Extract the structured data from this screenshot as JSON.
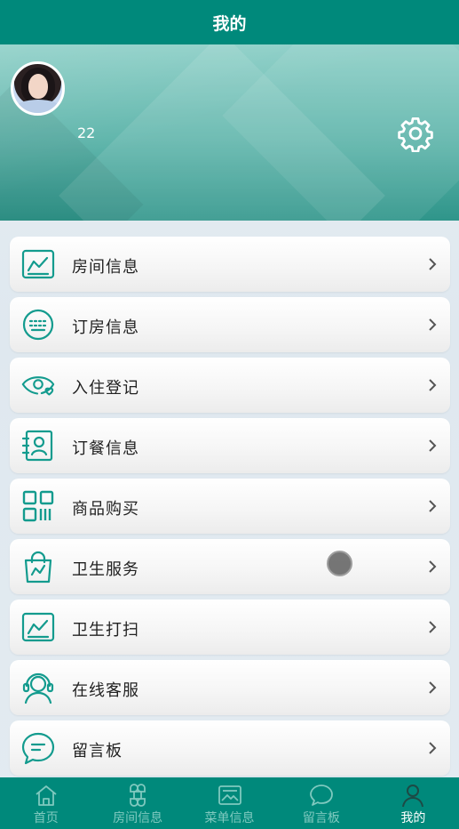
{
  "header": {
    "title": "我的"
  },
  "profile": {
    "username": "22",
    "avatar": "avatar-photo",
    "settings_icon": "gear-icon"
  },
  "menu": {
    "items": [
      {
        "label": "房间信息",
        "icon": "chart-frame-icon"
      },
      {
        "label": "订房信息",
        "icon": "keyboard-circle-icon"
      },
      {
        "label": "入住登记",
        "icon": "eye-heart-icon"
      },
      {
        "label": "订餐信息",
        "icon": "contact-card-icon"
      },
      {
        "label": "商品购买",
        "icon": "qr-code-icon"
      },
      {
        "label": "卫生服务",
        "icon": "shopping-bag-icon"
      },
      {
        "label": "卫生打扫",
        "icon": "chart-frame-icon"
      },
      {
        "label": "在线客服",
        "icon": "headset-agent-icon"
      },
      {
        "label": "留言板",
        "icon": "chat-bubble-icon"
      }
    ]
  },
  "tabbar": {
    "items": [
      {
        "label": "首页",
        "icon": "home-icon",
        "active": false
      },
      {
        "label": "房间信息",
        "icon": "command-icon",
        "active": false
      },
      {
        "label": "菜单信息",
        "icon": "image-frame-icon",
        "active": false
      },
      {
        "label": "留言板",
        "icon": "chat-bubble-icon",
        "active": false
      },
      {
        "label": "我的",
        "icon": "user-icon",
        "active": true
      }
    ]
  },
  "colors": {
    "primary": "#00897b",
    "icon": "#139b8e",
    "tab_inactive": "#7fc9bf",
    "tab_active": "#ffffff"
  }
}
